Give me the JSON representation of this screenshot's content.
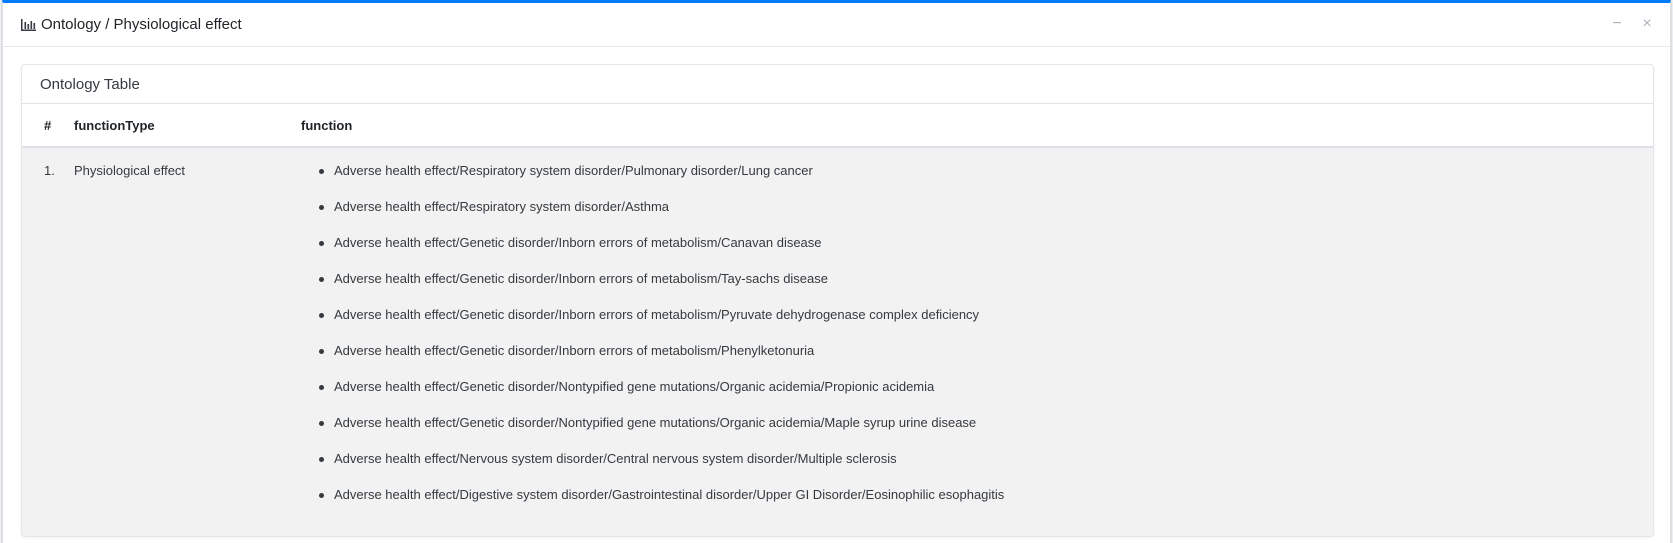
{
  "header": {
    "title": "Ontology / Physiological effect",
    "icon": "bar-chart-icon",
    "tools": {
      "minimize": "−",
      "close": "×"
    }
  },
  "card": {
    "title": "Ontology Table"
  },
  "table": {
    "columns": [
      "#",
      "functionType",
      "function"
    ],
    "rows": [
      {
        "num": "1.",
        "functionType": "Physiological effect",
        "functions": [
          "Adverse health effect/Respiratory system disorder/Pulmonary disorder/Lung cancer",
          "Adverse health effect/Respiratory system disorder/Asthma",
          "Adverse health effect/Genetic disorder/Inborn errors of metabolism/Canavan disease",
          "Adverse health effect/Genetic disorder/Inborn errors of metabolism/Tay-sachs disease",
          "Adverse health effect/Genetic disorder/Inborn errors of metabolism/Pyruvate dehydrogenase complex deficiency",
          "Adverse health effect/Genetic disorder/Inborn errors of metabolism/Phenylketonuria",
          "Adverse health effect/Genetic disorder/Nontypified gene mutations/Organic acidemia/Propionic acidemia",
          "Adverse health effect/Genetic disorder/Nontypified gene mutations/Organic acidemia/Maple syrup urine disease",
          "Adverse health effect/Nervous system disorder/Central nervous system disorder/Multiple sclerosis",
          "Adverse health effect/Digestive system disorder/Gastrointestinal disorder/Upper GI Disorder/Eosinophilic esophagitis"
        ]
      }
    ]
  },
  "colors": {
    "accent": "#007bff",
    "row_bg": "#f2f2f2",
    "tool_icon": "#adb5bd"
  }
}
